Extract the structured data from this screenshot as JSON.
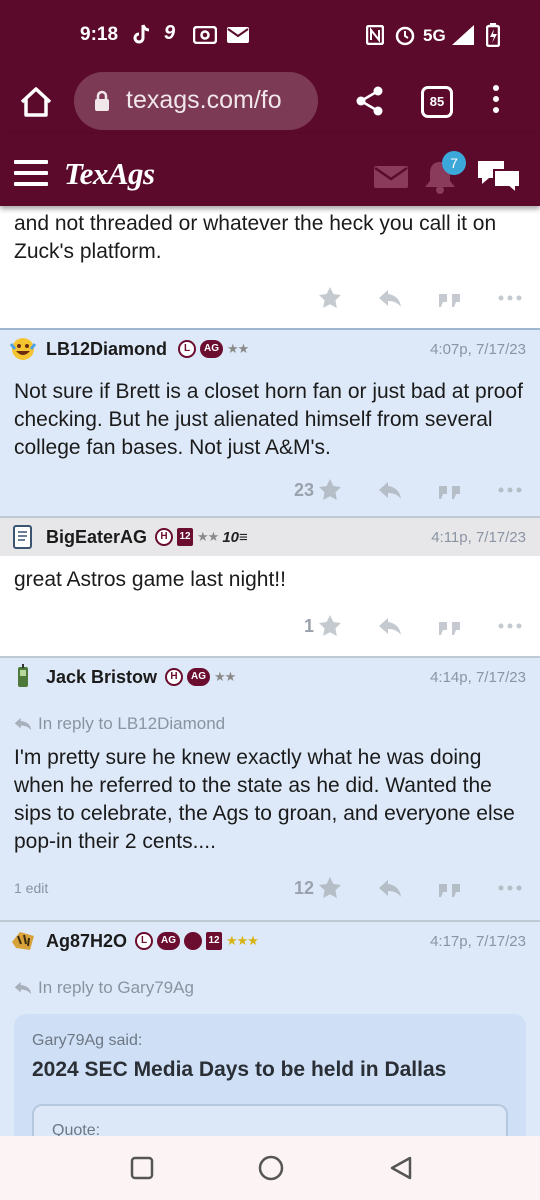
{
  "status_bar": {
    "time": "9:18",
    "network": "5G"
  },
  "browser": {
    "url": "texags.com/fo",
    "tab_count": "85"
  },
  "site": {
    "logo": "TexAgs",
    "notifications": "7"
  },
  "posts": [
    {
      "text": "and not threaded or whatever the heck you call it on Zuck's platform.",
      "count": ""
    },
    {
      "username": "LB12Diamond",
      "badge_l": "L",
      "badge_ag": "AG",
      "stars": "★★",
      "timestamp": "4:07p, 7/17/23",
      "text": "Not sure if Brett is a closet horn fan or just bad at proof checking. But he just alienated himself from several college fan bases. Not just A&M's.",
      "count": "23"
    },
    {
      "username": "BigEaterAG",
      "badge_h": "H",
      "badge_12": "12",
      "stars": "★★",
      "extra": "10≡",
      "timestamp": "4:11p, 7/17/23",
      "text": "great Astros game last night!!",
      "count": "1"
    },
    {
      "username": "Jack Bristow",
      "badge_h": "H",
      "badge_ag": "AG",
      "stars": "★★",
      "timestamp": "4:14p, 7/17/23",
      "reply_to": "In reply to LB12Diamond",
      "text": "I'm pretty sure he knew exactly what he was doing when he referred to the state as he did. Wanted the sips to celebrate, the Ags to groan, and everyone else pop-in their 2 cents....",
      "edits": "1 edit",
      "count": "12"
    },
    {
      "username": "Ag87H2O",
      "badge_l": "L",
      "badge_ag": "AG",
      "badge_12": "12",
      "stars": "★★★",
      "timestamp": "4:17p, 7/17/23",
      "reply_to": "In reply to Gary79Ag",
      "quote_by": "Gary79Ag said:",
      "quote_title": "2024 SEC Media Days to be held in Dallas",
      "inner_quote": "Quote:"
    }
  ]
}
